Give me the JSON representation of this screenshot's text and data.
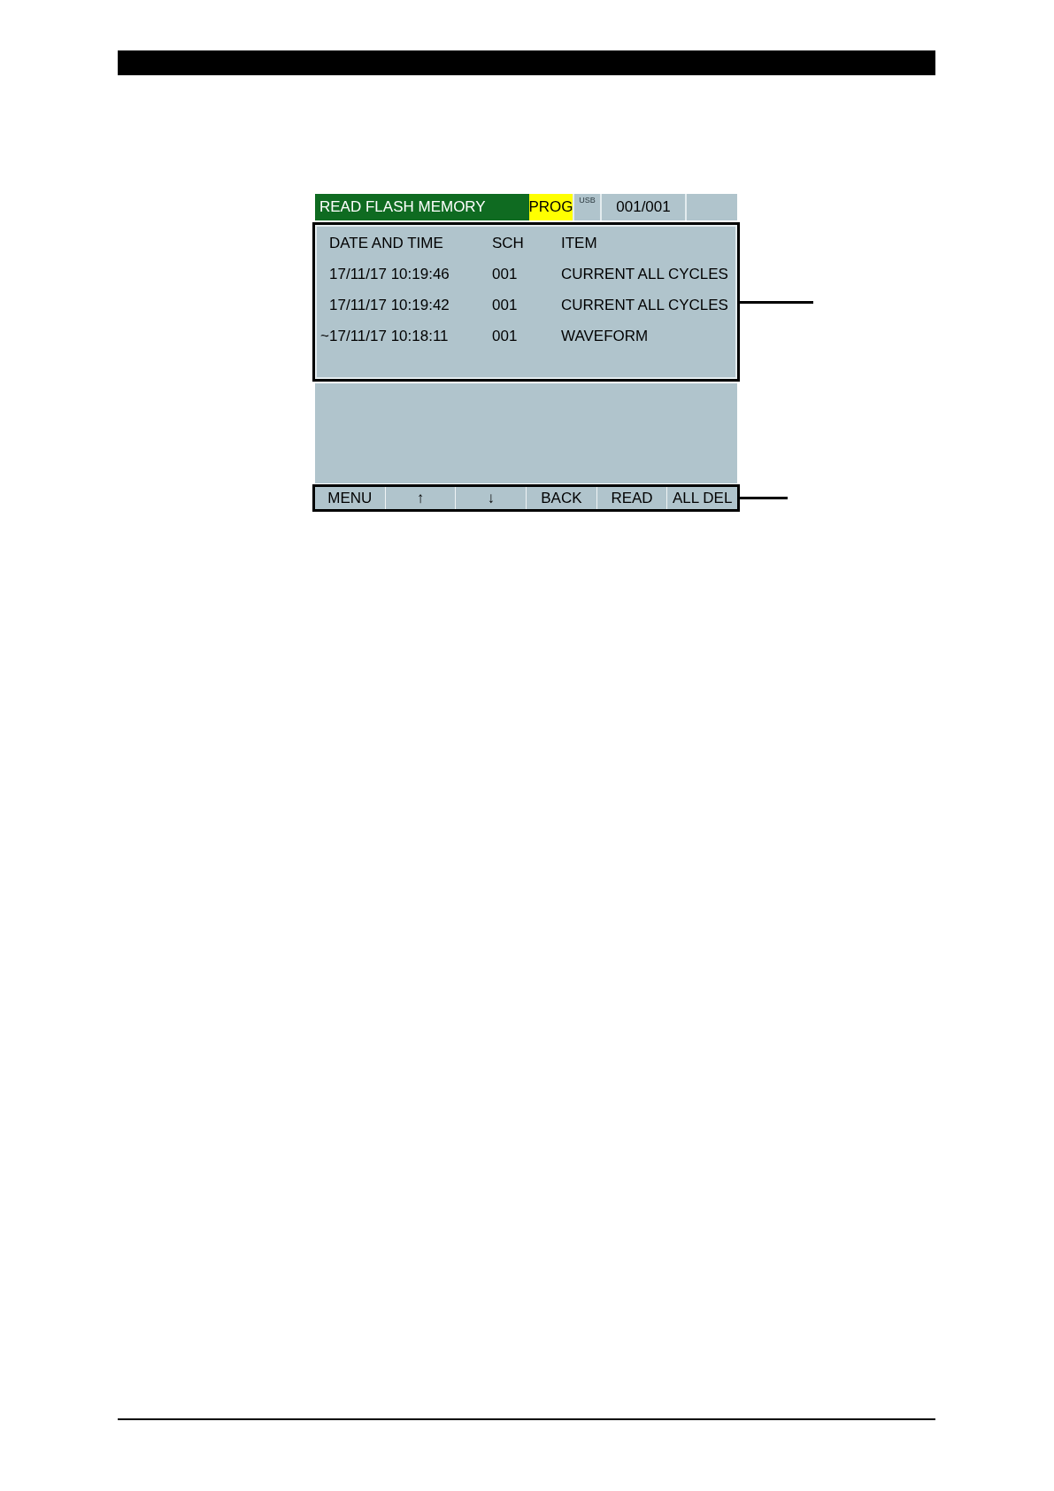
{
  "screen": {
    "title": "READ FLASH MEMORY",
    "mode_badge": "PROG",
    "usb_label": "USB",
    "page_counter": "001/001",
    "table": {
      "columns": [
        "DATE AND TIME",
        "SCH",
        "ITEM"
      ],
      "rows": [
        {
          "date_time": "17/11/17 10:19:46",
          "sch": "001",
          "item": "CURRENT ALL CYCLES"
        },
        {
          "date_time": "17/11/17 10:19:42",
          "sch": "001",
          "item": "CURRENT ALL CYCLES"
        },
        {
          "marker": "~",
          "date_time": "17/11/17 10:18:11",
          "sch": "001",
          "item": "WAVEFORM"
        }
      ]
    },
    "softkeys": [
      "MENU",
      "↑",
      "↓",
      "BACK",
      "READ",
      "ALL DEL"
    ]
  }
}
